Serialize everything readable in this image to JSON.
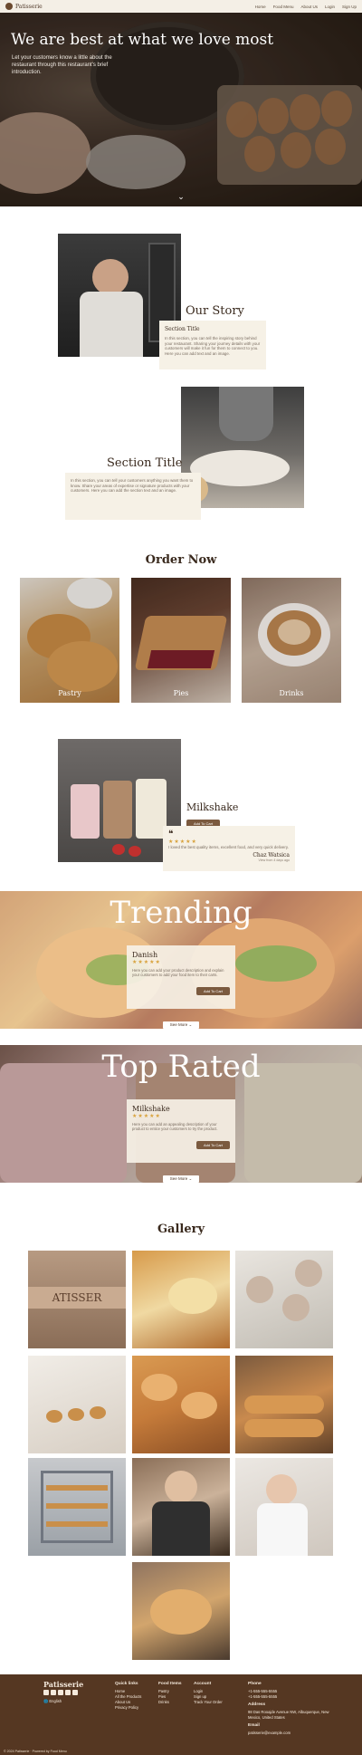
{
  "header": {
    "brand": "Patisserie",
    "nav": [
      "Home",
      "Food Menu",
      "About Us",
      "Login",
      "Sign Up"
    ]
  },
  "hero": {
    "title": "We are best at what we love most",
    "subtitle": "Let your customers know a little about the restaurant through this restaurant's brief introduction."
  },
  "story": {
    "title": "Our Story",
    "card_heading": "Section Title",
    "card_text": "In this section, you can tell the inspiring story behind your restaurant. Sharing your journey details with your customers will make it fun for them to connect to you. Here you can add text and an image.",
    "section2_title": "Section Title",
    "section2_text": "In this section, you can tell your customers anything you want them to know. Share your areas of expertise or signature products with your customers. Here you can add the section text and an image."
  },
  "order": {
    "title": "Order Now",
    "tiles": [
      "Pastry",
      "Pies",
      "Drinks"
    ]
  },
  "product": {
    "name": "Milkshake",
    "button": "Add To Cart",
    "stars": "★★★★★",
    "review": "I loved the best quality items, excellent food, and very quick delivery.",
    "reviewer": "Chaz Watsica",
    "review_time": "View from 4 days ago"
  },
  "trending": {
    "title": "Trending",
    "item": "Danish",
    "stars": "★★★★★",
    "desc": "Here you can add your product description and explain your customers to add your food item to their carts.",
    "button": "Add To Cart",
    "see_more": "See More"
  },
  "top_rated": {
    "title": "Top Rated",
    "item": "Milkshake",
    "stars": "★★★★★",
    "desc": "Here you can add an appealing description of your product to entice your customers to try the product.",
    "button": "Add To Cart",
    "see_more": "See More"
  },
  "gallery": {
    "title": "Gallery"
  },
  "footer": {
    "brand": "Patisserie",
    "language": "English",
    "quick_heading": "Quick links",
    "quick_links": [
      "Home",
      "All the Products",
      "About Us",
      "Privacy Policy"
    ],
    "food_heading": "Food Items",
    "food_links": [
      "Pastry",
      "Pies",
      "Drinks"
    ],
    "account_heading": "Account",
    "account_links": [
      "Login",
      "Sign up",
      "Track Your Order"
    ],
    "phone_heading": "Phone",
    "phones": [
      "+1-555-555-5555",
      "+1-555-555-5555"
    ],
    "address_heading": "Address",
    "address": "98 Das Rooajde Avenue NW, Albuquerque, New Mexico, United States",
    "email_heading": "Email",
    "email": "patisserie@example.com",
    "copyright": "© 2024 Patisserie · Powered by Food Menu"
  }
}
